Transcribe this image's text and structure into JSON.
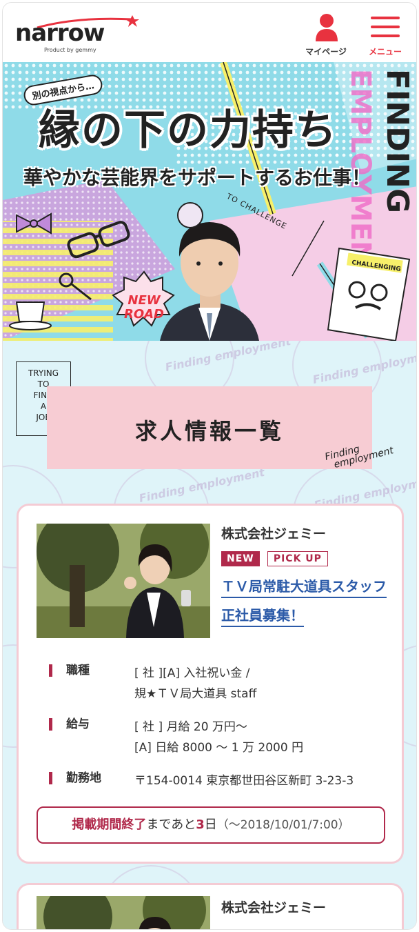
{
  "header": {
    "logo_text": "narrow",
    "logo_sub": "Product by gemmy",
    "mypage_label": "マイページ",
    "menu_label": "メニュー"
  },
  "hero": {
    "small_tag": "別の視点から…",
    "title": "縁の下の力持ち",
    "subtitle": "華やかな芸能界をサポートするお仕事！",
    "badge": [
      "NEW",
      "ROAD"
    ],
    "challenge_text": "TO CHALLENGE",
    "book_text": "CHALLENGING",
    "side_text": "FINDING EMPLOYMENT"
  },
  "section": {
    "try_box": [
      "TRYING",
      "TO",
      "FIND",
      "A",
      "JOB"
    ],
    "heading": "求人情報一覧",
    "signature": [
      "Finding",
      "employment"
    ],
    "pattern_text": "Finding employment"
  },
  "jobs": [
    {
      "company": "株式会社ジェミー",
      "badge_new": "NEW",
      "badge_pickup": "PICK UP",
      "title_line1": "ＴＶ局常駐大道具スタッフ",
      "title_line2": "正社員募集！",
      "rows": [
        {
          "label": "職種",
          "value_line1": "[ 社 ][A] 入社祝い金 /",
          "value_line2": "規★ＴＶ局大道具 staff"
        },
        {
          "label": "給与",
          "value_line1": "[ 社 ] 月給 20 万円〜",
          "value_line2": "[A] 日給 8000 〜 1 万 2000 円"
        },
        {
          "label": "勤務地",
          "value_line1": "〒154-0014 東京都世田谷区新町 3-23-3",
          "value_line2": ""
        }
      ],
      "deadline": {
        "prefix": "掲載期間終了",
        "middle": "まであと",
        "days": "3",
        "unit": "日",
        "date": "（〜2018/10/01/7:00）"
      }
    },
    {
      "company": "株式会社ジェミー"
    }
  ],
  "colors": {
    "accent_red": "#e8323f",
    "wine": "#b0294b",
    "link_blue": "#2b5aa8",
    "pink_block": "#f7ccd3",
    "pattern_bg": "#dff4f9"
  }
}
